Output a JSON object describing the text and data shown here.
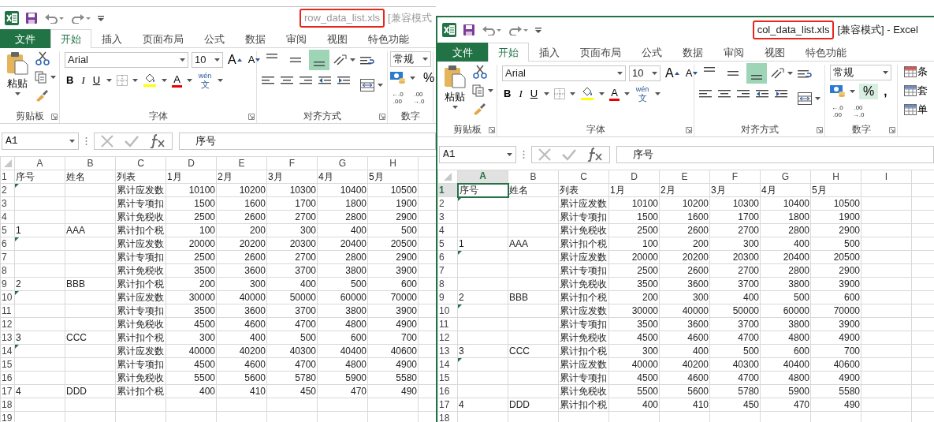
{
  "windows": [
    {
      "title": "row_data_list.xls",
      "title_suffix": "[兼容模式",
      "active": false,
      "tabs": [
        {
          "label": "文件",
          "kind": "file",
          "selected": false
        },
        {
          "label": "开始",
          "kind": "tab",
          "selected": true
        },
        {
          "label": "插入",
          "kind": "tab",
          "selected": false
        },
        {
          "label": "页面布局",
          "kind": "tab",
          "selected": false
        },
        {
          "label": "公式",
          "kind": "tab",
          "selected": false
        },
        {
          "label": "数据",
          "kind": "tab",
          "selected": false
        },
        {
          "label": "审阅",
          "kind": "tab",
          "selected": false
        },
        {
          "label": "视图",
          "kind": "tab",
          "selected": false
        },
        {
          "label": "特色功能",
          "kind": "tab",
          "selected": false
        }
      ],
      "clipboard": {
        "paste": "粘贴",
        "group": "剪贴板"
      },
      "font": {
        "name": "Arial",
        "size": "10",
        "grow": "A",
        "shrink": "A",
        "bold": "B",
        "italic": "I",
        "underline": "U",
        "color_button": "A",
        "phonetic_top": "wén",
        "phonetic_bottom": "文",
        "group": "字体"
      },
      "alignment": {
        "vertical_buttons": [
          {
            "selected": false
          },
          {
            "selected": false
          },
          {
            "selected": true
          }
        ],
        "group": "对齐方式"
      },
      "number": {
        "format": "常规",
        "percent": "%",
        "percent_hovered": false,
        "decimals": [
          {
            "top": "←.0",
            "bottom": ".00"
          },
          {
            "top": ".00",
            "bottom": "→.0"
          }
        ],
        "group": "数字"
      },
      "name_box": "A1",
      "formula": "序号",
      "columns": [
        {
          "label": "A",
          "selected": false
        },
        {
          "label": "B",
          "selected": false
        },
        {
          "label": "C",
          "selected": false
        },
        {
          "label": "D",
          "selected": false
        },
        {
          "label": "E",
          "selected": false
        },
        {
          "label": "F",
          "selected": false
        },
        {
          "label": "G",
          "selected": false
        },
        {
          "label": "H",
          "selected": false
        }
      ],
      "rows": [
        {
          "n": "1",
          "selected": false,
          "flag": false,
          "cells": [
            "序号",
            "姓名",
            "列表",
            "1月",
            "2月",
            "3月",
            "4月",
            "5月"
          ]
        },
        {
          "n": "2",
          "selected": false,
          "flag": true,
          "cells": [
            null,
            null,
            "累计应发数",
            "10100",
            "10200",
            "10300",
            "10400",
            "10500"
          ]
        },
        {
          "n": "3",
          "selected": false,
          "flag": false,
          "cells": [
            null,
            null,
            "累计专项扣",
            "1500",
            "1600",
            "1700",
            "1800",
            "1900"
          ]
        },
        {
          "n": "4",
          "selected": false,
          "flag": false,
          "cells": [
            null,
            null,
            "累计免税收",
            "2500",
            "2600",
            "2700",
            "2800",
            "2900"
          ]
        },
        {
          "n": "5",
          "selected": false,
          "flag": false,
          "cells": [
            "1",
            "AAA",
            "累计扣个税",
            "100",
            "200",
            "300",
            "400",
            "500"
          ]
        },
        {
          "n": "6",
          "selected": false,
          "flag": true,
          "cells": [
            null,
            null,
            "累计应发数",
            "20000",
            "20200",
            "20300",
            "20400",
            "20500"
          ]
        },
        {
          "n": "7",
          "selected": false,
          "flag": false,
          "cells": [
            null,
            null,
            "累计专项扣",
            "2500",
            "2600",
            "2700",
            "2800",
            "2900"
          ]
        },
        {
          "n": "8",
          "selected": false,
          "flag": false,
          "cells": [
            null,
            null,
            "累计免税收",
            "3500",
            "3600",
            "3700",
            "3800",
            "3900"
          ]
        },
        {
          "n": "9",
          "selected": false,
          "flag": false,
          "cells": [
            "2",
            "BBB",
            "累计扣个税",
            "200",
            "300",
            "400",
            "500",
            "600"
          ]
        },
        {
          "n": "10",
          "selected": false,
          "flag": true,
          "cells": [
            null,
            null,
            "累计应发数",
            "30000",
            "40000",
            "50000",
            "60000",
            "70000"
          ]
        },
        {
          "n": "11",
          "selected": false,
          "flag": false,
          "cells": [
            null,
            null,
            "累计专项扣",
            "3500",
            "3600",
            "3700",
            "3800",
            "3900"
          ]
        },
        {
          "n": "12",
          "selected": false,
          "flag": false,
          "cells": [
            null,
            null,
            "累计免税收",
            "4500",
            "4600",
            "4700",
            "4800",
            "4900"
          ]
        },
        {
          "n": "13",
          "selected": false,
          "flag": false,
          "cells": [
            "3",
            "CCC",
            "累计扣个税",
            "300",
            "400",
            "500",
            "600",
            "700"
          ]
        },
        {
          "n": "14",
          "selected": false,
          "flag": true,
          "cells": [
            null,
            null,
            "累计应发数",
            "40000",
            "40200",
            "40300",
            "40400",
            "40600"
          ]
        },
        {
          "n": "15",
          "selected": false,
          "flag": false,
          "cells": [
            null,
            null,
            "累计专项扣",
            "4500",
            "4600",
            "4700",
            "4800",
            "4900"
          ]
        },
        {
          "n": "16",
          "selected": false,
          "flag": false,
          "cells": [
            null,
            null,
            "累计免税收",
            "5500",
            "5600",
            "5780",
            "5900",
            "5580"
          ]
        },
        {
          "n": "17",
          "selected": false,
          "flag": false,
          "cells": [
            "4",
            "DDD",
            "累计扣个税",
            "400",
            "410",
            "450",
            "470",
            "490"
          ]
        },
        {
          "n": "18",
          "selected": false,
          "flag": false
        },
        {
          "n": "19",
          "selected": false,
          "flag": false
        }
      ]
    },
    {
      "title": "col_data_list.xls",
      "title_suffix": "[兼容模式] - Excel",
      "active": true,
      "tabs": [
        {
          "label": "文件",
          "kind": "file",
          "selected": false
        },
        {
          "label": "开始",
          "kind": "tab",
          "selected": true
        },
        {
          "label": "插入",
          "kind": "tab",
          "selected": false
        },
        {
          "label": "页面布局",
          "kind": "tab",
          "selected": false
        },
        {
          "label": "公式",
          "kind": "tab",
          "selected": false
        },
        {
          "label": "数据",
          "kind": "tab",
          "selected": false
        },
        {
          "label": "审阅",
          "kind": "tab",
          "selected": false
        },
        {
          "label": "视图",
          "kind": "tab",
          "selected": false
        },
        {
          "label": "特色功能",
          "kind": "tab",
          "selected": false
        }
      ],
      "clipboard": {
        "paste": "粘贴",
        "group": "剪贴板"
      },
      "font": {
        "name": "Arial",
        "size": "10",
        "grow": "A",
        "shrink": "A",
        "bold": "B",
        "italic": "I",
        "underline": "U",
        "color_button": "A",
        "phonetic_top": "wén",
        "phonetic_bottom": "文",
        "group": "字体"
      },
      "alignment": {
        "vertical_buttons": [
          {
            "selected": false
          },
          {
            "selected": false
          },
          {
            "selected": true
          }
        ],
        "group": "对齐方式"
      },
      "number": {
        "format": "常规",
        "percent": "%",
        "percent_hovered": true,
        "comma": ",",
        "decimals": [
          {
            "top": "←.0",
            "bottom": ".00"
          },
          {
            "top": ".00",
            "bottom": "→.0"
          }
        ],
        "group": "数字"
      },
      "styles": [
        "条",
        "套",
        "单"
      ],
      "name_box": "A1",
      "formula": "序号",
      "columns": [
        {
          "label": "A",
          "selected": true
        },
        {
          "label": "B",
          "selected": false
        },
        {
          "label": "C",
          "selected": false
        },
        {
          "label": "D",
          "selected": false
        },
        {
          "label": "E",
          "selected": false
        },
        {
          "label": "F",
          "selected": false
        },
        {
          "label": "G",
          "selected": false
        },
        {
          "label": "H",
          "selected": false
        },
        {
          "label": "I",
          "selected": false
        }
      ],
      "rows": [
        {
          "n": "1",
          "selected": true,
          "flag": false,
          "cells": [
            "序号",
            "姓名",
            "列表",
            "1月",
            "2月",
            "3月",
            "4月",
            "5月"
          ]
        },
        {
          "n": "2",
          "selected": false,
          "flag": true,
          "cells": [
            null,
            null,
            "累计应发数",
            "10100",
            "10200",
            "10300",
            "10400",
            "10500"
          ]
        },
        {
          "n": "3",
          "selected": false,
          "flag": false,
          "cells": [
            null,
            null,
            "累计专项扣",
            "1500",
            "1600",
            "1700",
            "1800",
            "1900"
          ]
        },
        {
          "n": "4",
          "selected": false,
          "flag": false,
          "cells": [
            null,
            null,
            "累计免税收",
            "2500",
            "2600",
            "2700",
            "2800",
            "2900"
          ]
        },
        {
          "n": "5",
          "selected": false,
          "flag": false,
          "cells": [
            "1",
            "AAA",
            "累计扣个税",
            "100",
            "200",
            "300",
            "400",
            "500"
          ]
        },
        {
          "n": "6",
          "selected": false,
          "flag": true,
          "cells": [
            null,
            null,
            "累计应发数",
            "20000",
            "20200",
            "20300",
            "20400",
            "20500"
          ]
        },
        {
          "n": "7",
          "selected": false,
          "flag": false,
          "cells": [
            null,
            null,
            "累计专项扣",
            "2500",
            "2600",
            "2700",
            "2800",
            "2900"
          ]
        },
        {
          "n": "8",
          "selected": false,
          "flag": false,
          "cells": [
            null,
            null,
            "累计免税收",
            "3500",
            "3600",
            "3700",
            "3800",
            "3900"
          ]
        },
        {
          "n": "9",
          "selected": false,
          "flag": false,
          "cells": [
            "2",
            "BBB",
            "累计扣个税",
            "200",
            "300",
            "400",
            "500",
            "600"
          ]
        },
        {
          "n": "10",
          "selected": false,
          "flag": true,
          "cells": [
            null,
            null,
            "累计应发数",
            "30000",
            "40000",
            "50000",
            "60000",
            "70000"
          ]
        },
        {
          "n": "11",
          "selected": false,
          "flag": false,
          "cells": [
            null,
            null,
            "累计专项扣",
            "3500",
            "3600",
            "3700",
            "3800",
            "3900"
          ]
        },
        {
          "n": "12",
          "selected": false,
          "flag": false,
          "cells": [
            null,
            null,
            "累计免税收",
            "4500",
            "4600",
            "4700",
            "4800",
            "4900"
          ]
        },
        {
          "n": "13",
          "selected": false,
          "flag": false,
          "cells": [
            "3",
            "CCC",
            "累计扣个税",
            "300",
            "400",
            "500",
            "600",
            "700"
          ]
        },
        {
          "n": "14",
          "selected": false,
          "flag": true,
          "cells": [
            null,
            null,
            "累计应发数",
            "40000",
            "40200",
            "40300",
            "40400",
            "40600"
          ]
        },
        {
          "n": "15",
          "selected": false,
          "flag": false,
          "cells": [
            null,
            null,
            "累计专项扣",
            "4500",
            "4600",
            "4700",
            "4800",
            "4900"
          ]
        },
        {
          "n": "16",
          "selected": false,
          "flag": false,
          "cells": [
            null,
            null,
            "累计免税收",
            "5500",
            "5600",
            "5780",
            "5900",
            "5580"
          ]
        },
        {
          "n": "17",
          "selected": false,
          "flag": false,
          "cells": [
            "4",
            "DDD",
            "累计扣个税",
            "400",
            "410",
            "450",
            "470",
            "490"
          ]
        },
        {
          "n": "18",
          "selected": false,
          "flag": false
        }
      ]
    }
  ]
}
